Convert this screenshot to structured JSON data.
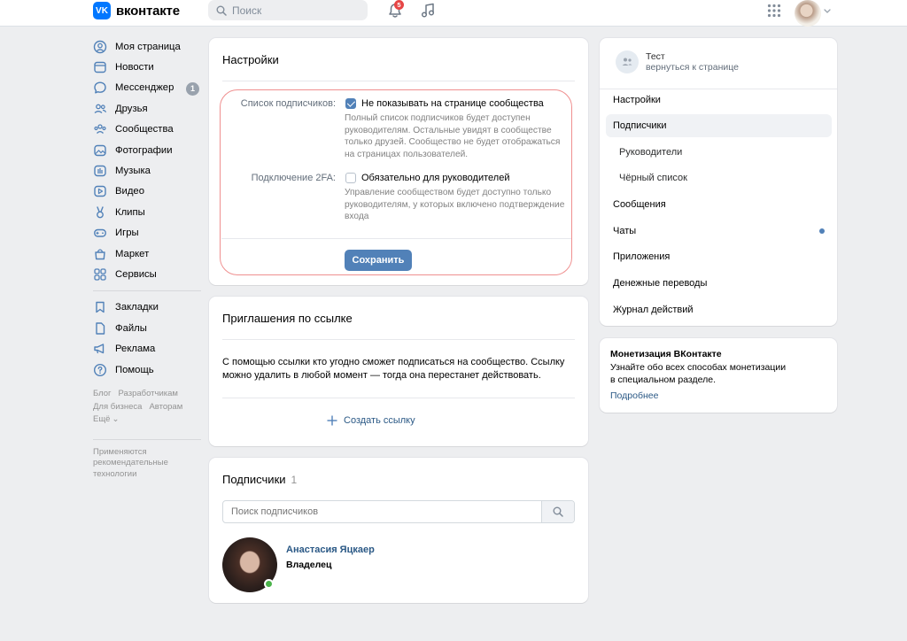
{
  "header": {
    "logo_text": "вконтакте",
    "search_placeholder": "Поиск",
    "notifications_count": "5"
  },
  "sidebar": {
    "items": [
      {
        "label": "Моя страница",
        "icon": "user-circle-icon"
      },
      {
        "label": "Новости",
        "icon": "news-icon"
      },
      {
        "label": "Мессенджер",
        "icon": "message-icon",
        "badge": "1"
      },
      {
        "label": "Друзья",
        "icon": "friends-icon"
      },
      {
        "label": "Сообщества",
        "icon": "communities-icon"
      },
      {
        "label": "Фотографии",
        "icon": "photo-icon"
      },
      {
        "label": "Музыка",
        "icon": "music-icon"
      },
      {
        "label": "Видео",
        "icon": "video-icon"
      },
      {
        "label": "Клипы",
        "icon": "clips-icon"
      },
      {
        "label": "Игры",
        "icon": "gamepad-icon"
      },
      {
        "label": "Маркет",
        "icon": "market-icon"
      },
      {
        "label": "Сервисы",
        "icon": "services-icon"
      }
    ],
    "items2": [
      {
        "label": "Закладки",
        "icon": "bookmark-icon"
      },
      {
        "label": "Файлы",
        "icon": "file-icon"
      },
      {
        "label": "Реклама",
        "icon": "megaphone-icon"
      },
      {
        "label": "Помощь",
        "icon": "help-icon"
      }
    ],
    "footer": {
      "blog": "Блог",
      "developers": "Разработчикам",
      "business": "Для бизнеса",
      "authors": "Авторам",
      "more": "Ещё",
      "recommend": "Применяются рекомендательные технологии"
    }
  },
  "settings": {
    "title": "Настройки",
    "subscribers_list_label": "Список подписчиков:",
    "hide_checkbox_label": "Не показывать на странице сообщества",
    "hide_checked": true,
    "hide_hint": "Полный список подписчиков будет доступен руководителям. Остальные увидят в сообществе только друзей. Сообщество не будет отображаться на страницах пользователей.",
    "twofa_label": "Подключение 2FA:",
    "twofa_checkbox_label": "Обязательно для руководителей",
    "twofa_checked": false,
    "twofa_hint": "Управление сообществом будет доступно только руководителям, у которых включено подтверждение входа",
    "save_button": "Сохранить"
  },
  "invites": {
    "title": "Приглашения по ссылке",
    "description": "С помощью ссылки кто угодно сможет подписаться на сообщество. Ссылку можно удалить в любой момент — тогда она перестанет действовать.",
    "create_link": "Создать ссылку"
  },
  "subscribers": {
    "title": "Подписчики",
    "count": "1",
    "search_placeholder": "Поиск подписчиков",
    "list": [
      {
        "name": "Анастасия Яцкаер",
        "role": "Владелец",
        "online": true
      }
    ]
  },
  "right_panel": {
    "group_name": "Тест",
    "back_link": "вернуться к странице",
    "menu": [
      {
        "label": "Настройки",
        "sub": false,
        "active": false
      },
      {
        "label": "Подписчики",
        "sub": false,
        "active": true
      },
      {
        "label": "Руководители",
        "sub": true,
        "active": false
      },
      {
        "label": "Чёрный список",
        "sub": true,
        "active": false
      },
      {
        "label": "Сообщения",
        "sub": false,
        "active": false
      },
      {
        "label": "Чаты",
        "sub": false,
        "active": false,
        "dot": true
      },
      {
        "label": "Приложения",
        "sub": false,
        "active": false
      },
      {
        "label": "Денежные переводы",
        "sub": false,
        "active": false
      },
      {
        "label": "Журнал действий",
        "sub": false,
        "active": false
      }
    ]
  },
  "monetization": {
    "title": "Монетизация ВКонтакте",
    "text": "Узнайте обо всех способах монетизации в специальном разделе.",
    "link": "Подробнее"
  },
  "colors": {
    "accent": "#5181b8",
    "highlight": "#ef8f8f",
    "link": "#2a5885"
  }
}
